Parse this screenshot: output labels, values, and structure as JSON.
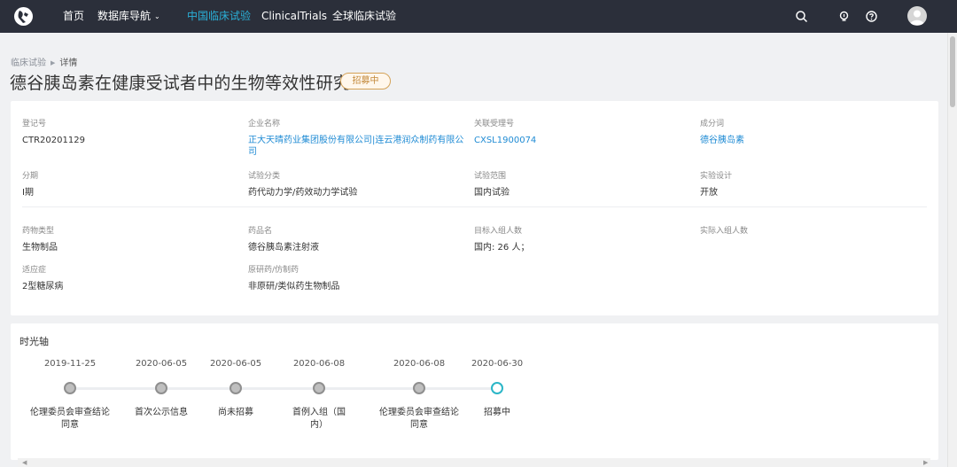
{
  "nav": {
    "items": [
      {
        "label": "首页"
      },
      {
        "label": "数据库导航"
      },
      {
        "label": "中国临床试验"
      },
      {
        "label": "ClinicalTrials"
      },
      {
        "label": "全球临床试验"
      }
    ],
    "active_color": "#2ab0d8",
    "icons": [
      "search-icon",
      "bulb-icon",
      "help-icon",
      "user-avatar"
    ]
  },
  "breadcrumb": {
    "root": "临床试验",
    "current": "详情"
  },
  "title": "德谷胰岛素在健康受试者中的生物等效性研究",
  "status": "招募中",
  "fields": {
    "reg_no": {
      "label": "登记号",
      "value": "CTR20201129"
    },
    "company": {
      "label": "企业名称",
      "value": "正大天晴药业集团股份有限公司|连云港润众制药有限公司"
    },
    "acceptance_no": {
      "label": "关联受理号",
      "value": "CXSL1900074"
    },
    "ingredient": {
      "label": "成分词",
      "value": "德谷胰岛素"
    },
    "phase": {
      "label": "分期",
      "value": "I期"
    },
    "trial_type": {
      "label": "试验分类",
      "value": "药代动力学/药效动力学试验"
    },
    "scope": {
      "label": "试验范围",
      "value": "国内试验"
    },
    "design": {
      "label": "实验设计",
      "value": "开放"
    },
    "drug_type": {
      "label": "药物类型",
      "value": "生物制品"
    },
    "drug_name": {
      "label": "药品名",
      "value": "德谷胰岛素注射液"
    },
    "target_enroll": {
      "label": "目标入组人数",
      "value": "国内: 26 人；"
    },
    "actual_enroll": {
      "label": "实际入组人数",
      "value": ""
    },
    "indication": {
      "label": "适应症",
      "value": "2型糖尿病"
    },
    "original": {
      "label": "原研药/仿制药",
      "value": "非原研/类似药生物制品"
    }
  },
  "timeline": {
    "title": "时光轴",
    "events": [
      {
        "date": "2019-11-25",
        "label": "伦理委员会审查结论同意"
      },
      {
        "date": "2020-06-05",
        "label": "首次公示信息"
      },
      {
        "date": "2020-06-05",
        "label": "尚未招募"
      },
      {
        "date": "2020-06-08",
        "label": "首例入组（国内）"
      },
      {
        "date": "2020-06-08",
        "label": "伦理委员会审查结论同意"
      },
      {
        "date": "2020-06-30",
        "label": "招募中",
        "current": true
      }
    ]
  }
}
